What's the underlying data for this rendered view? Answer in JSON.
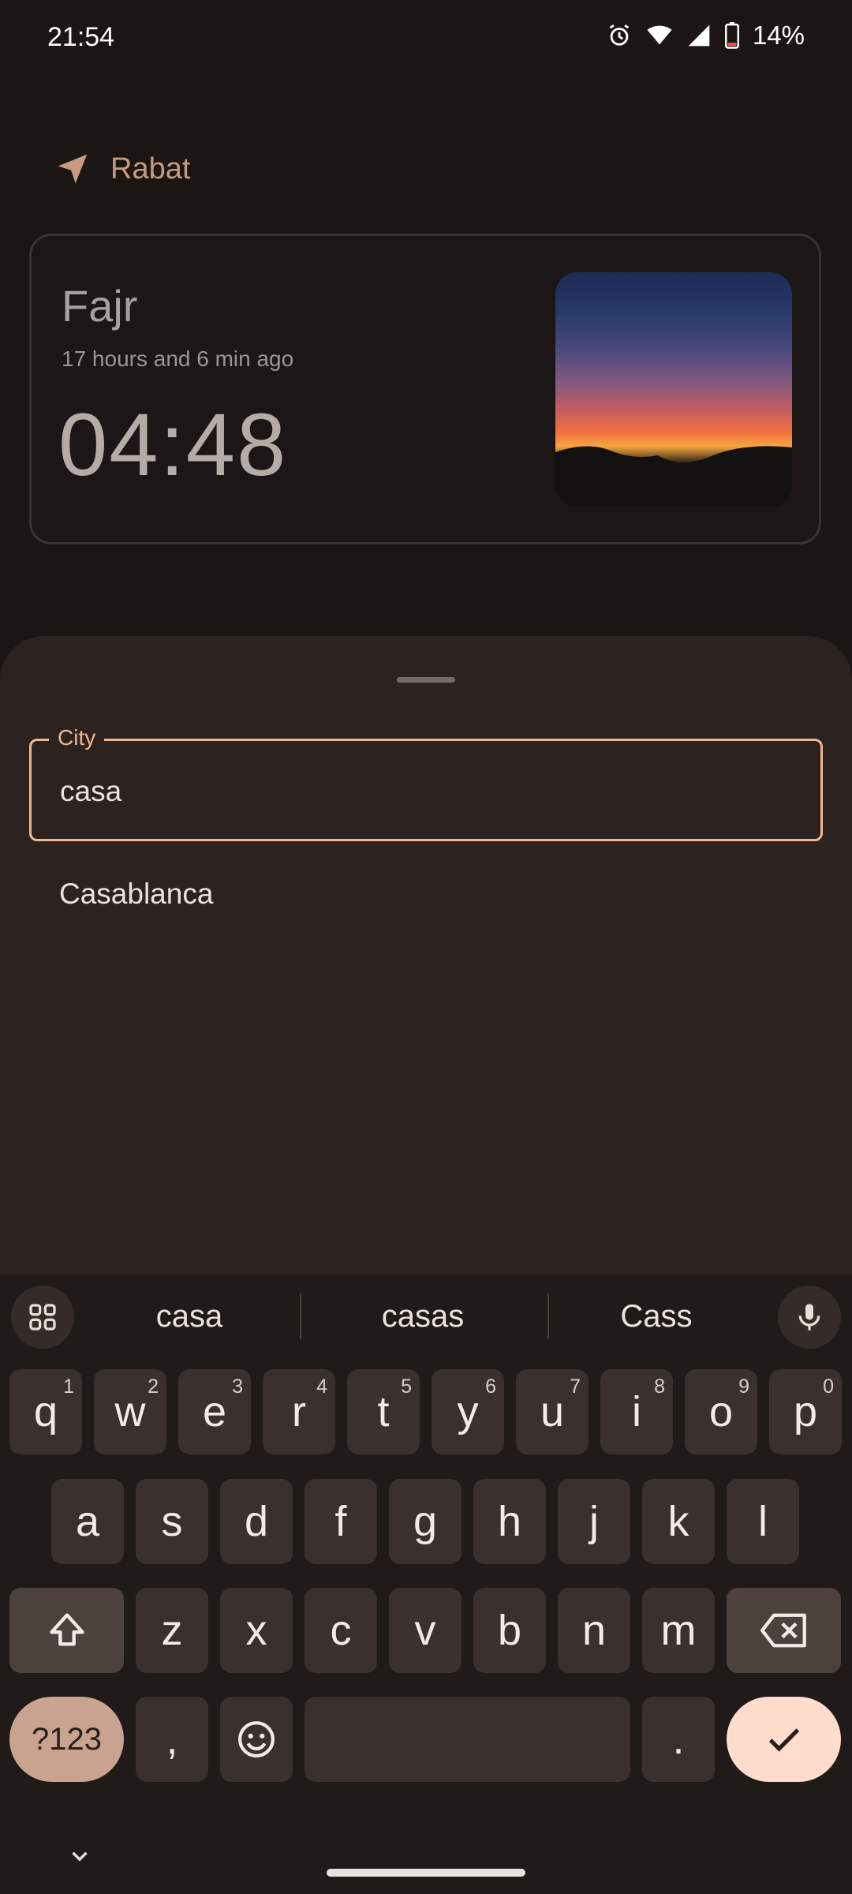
{
  "status_bar": {
    "time": "21:54",
    "battery": "14%",
    "icons": [
      "alarm-icon",
      "wifi-icon",
      "signal-icon",
      "battery-icon"
    ]
  },
  "location": {
    "name": "Rabat",
    "icon": "navigation-arrow-icon"
  },
  "prayer_card": {
    "name": "Fajr",
    "relative": "17 hours and 6 min ago",
    "time": "04:48",
    "image": "sunrise-sky"
  },
  "city_sheet": {
    "field_label": "City",
    "field_value": "casa",
    "suggestions": [
      "Casablanca"
    ]
  },
  "keyboard": {
    "suggestions": [
      "casa",
      "casas",
      "Cass"
    ],
    "row1": [
      {
        "k": "q",
        "n": "1"
      },
      {
        "k": "w",
        "n": "2"
      },
      {
        "k": "e",
        "n": "3"
      },
      {
        "k": "r",
        "n": "4"
      },
      {
        "k": "t",
        "n": "5"
      },
      {
        "k": "y",
        "n": "6"
      },
      {
        "k": "u",
        "n": "7"
      },
      {
        "k": "i",
        "n": "8"
      },
      {
        "k": "o",
        "n": "9"
      },
      {
        "k": "p",
        "n": "0"
      }
    ],
    "row2": [
      "a",
      "s",
      "d",
      "f",
      "g",
      "h",
      "j",
      "k",
      "l"
    ],
    "row3": [
      "z",
      "x",
      "c",
      "v",
      "b",
      "n",
      "m"
    ],
    "symbols_label": "?123",
    "comma": ",",
    "period": "."
  },
  "colors": {
    "accent": "#f1b790",
    "sheet_bg": "#2c2320",
    "page_bg": "#1b1614",
    "enter_key": "#ffdccb"
  }
}
